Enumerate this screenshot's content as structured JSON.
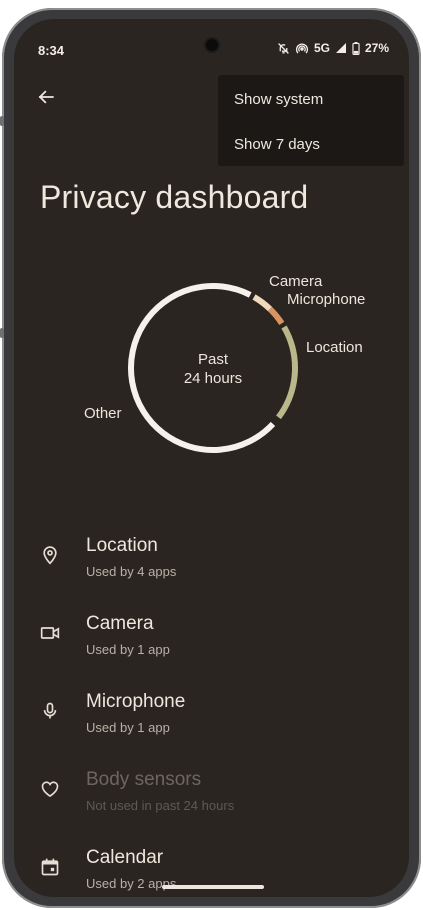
{
  "status_bar": {
    "time": "8:34",
    "network": "5G",
    "battery": "27%",
    "icons": [
      "mute-icon",
      "hotspot-icon",
      "signal-icon",
      "battery-icon"
    ]
  },
  "menu": {
    "items": [
      {
        "label": "Show system"
      },
      {
        "label": "Show 7 days"
      }
    ]
  },
  "page": {
    "title": "Privacy dashboard"
  },
  "chart_data": {
    "type": "pie",
    "style": "donut",
    "center_text": [
      "Past",
      "24 hours"
    ],
    "slices": [
      {
        "label": "Camera",
        "color": "#f0d9bd"
      },
      {
        "label": "Microphone",
        "color": "#d9955f"
      },
      {
        "label": "Location",
        "color": "#b9b88b"
      },
      {
        "label": "Other",
        "color": "#f6f1ea"
      }
    ]
  },
  "permissions": [
    {
      "title": "Location",
      "subtitle": "Used by 4 apps",
      "icon": "location-pin-icon",
      "enabled": true
    },
    {
      "title": "Camera",
      "subtitle": "Used by 1 app",
      "icon": "video-camera-icon",
      "enabled": true
    },
    {
      "title": "Microphone",
      "subtitle": "Used by 1 app",
      "icon": "microphone-icon",
      "enabled": true
    },
    {
      "title": "Body sensors",
      "subtitle": "Not used in past 24 hours",
      "icon": "heart-icon",
      "enabled": false
    },
    {
      "title": "Calendar",
      "subtitle": "Used by 2 apps",
      "icon": "calendar-icon",
      "enabled": true
    }
  ],
  "colors": {
    "background": "#2a2520",
    "menu_background": "#1b1816",
    "text_primary": "#eee7de",
    "text_secondary": "#b9b1a7",
    "text_disabled": "#6d665f"
  }
}
